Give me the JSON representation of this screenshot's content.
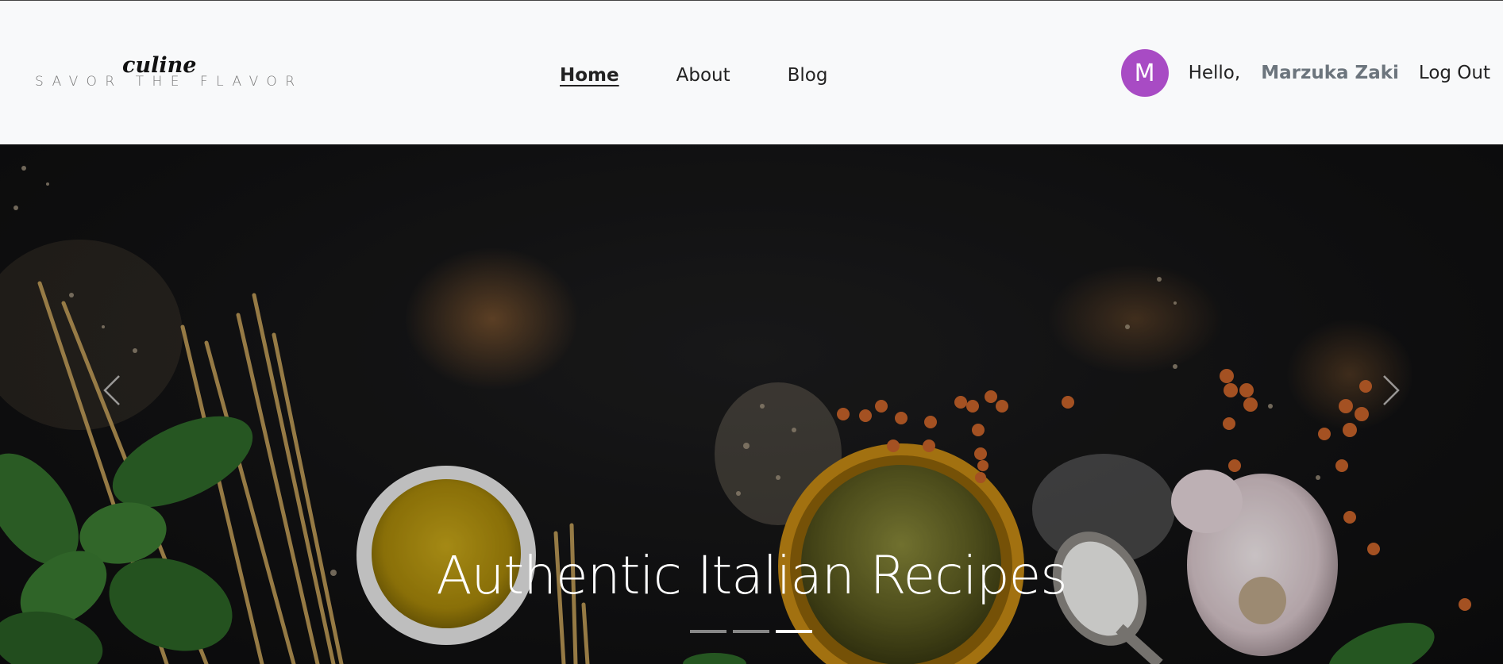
{
  "brand": {
    "script_name": "culine",
    "tagline": "SAVOR THE FLAVOR"
  },
  "nav": {
    "items": [
      {
        "label": "Home",
        "active": true
      },
      {
        "label": "About",
        "active": false
      },
      {
        "label": "Blog",
        "active": false
      }
    ]
  },
  "user": {
    "avatar_initial": "M",
    "avatar_color": "#a84bc4",
    "greeting": "Hello,",
    "name": "Marzuka Zaki",
    "logout_label": "Log Out"
  },
  "carousel": {
    "caption": "Authentic Italian Recipes",
    "slide_count": 3,
    "active_slide": 3,
    "prev_icon": "chevron-left-icon",
    "next_icon": "chevron-right-icon"
  }
}
